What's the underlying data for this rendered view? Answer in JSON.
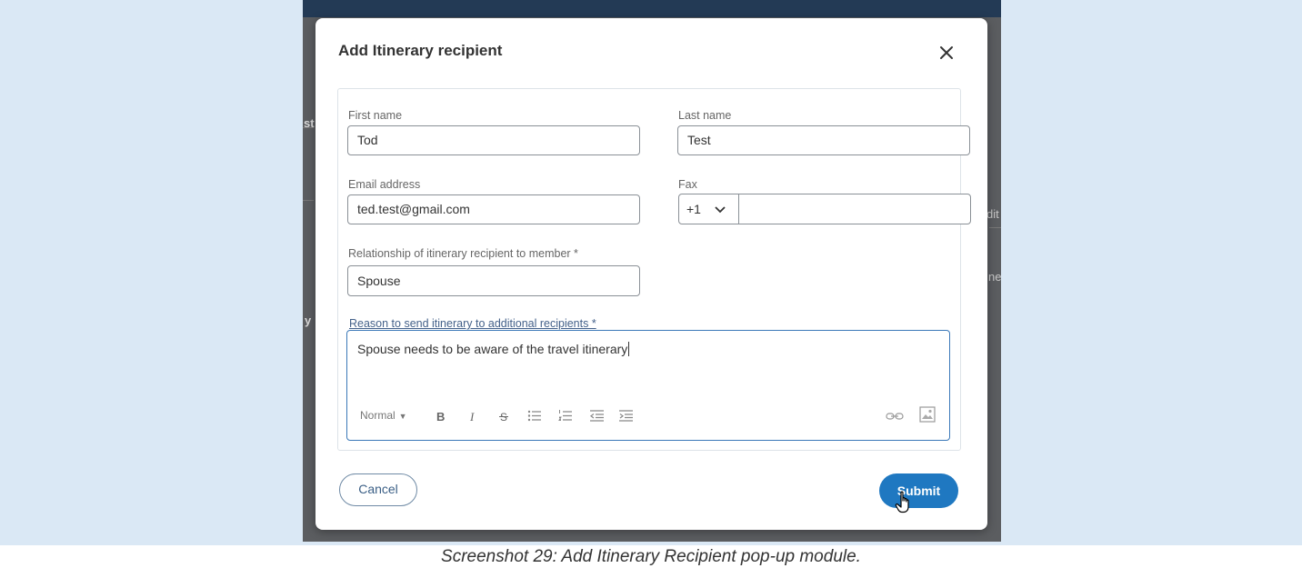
{
  "caption": "Screenshot 29: Add Itinerary Recipient pop-up module.",
  "background_fragments": [
    "st",
    "y",
    "ne",
    "dit"
  ],
  "modal": {
    "title": "Add Itinerary recipient",
    "fields": {
      "first_name": {
        "label": "First name",
        "value": "Tod"
      },
      "last_name": {
        "label": "Last name",
        "value": "Test"
      },
      "email": {
        "label": "Email address",
        "value": "ted.test@gmail.com"
      },
      "fax": {
        "label": "Fax",
        "country_code": "+1",
        "value": ""
      },
      "relationship": {
        "label": "Relationship of itinerary recipient to member *",
        "value": "Spouse"
      },
      "reason": {
        "label": "Reason to send itinerary to additional recipients *",
        "value": "Spouse needs to be aware of the travel itinerary"
      }
    },
    "editor_toolbar": {
      "format_label": "Normal"
    },
    "buttons": {
      "cancel": "Cancel",
      "submit": "Submit"
    }
  },
  "colors": {
    "page_background": "#dae8f5",
    "overlay": "#5b5d60",
    "primary_button": "#1f78c1",
    "editor_focus_border": "#3a78b8"
  }
}
